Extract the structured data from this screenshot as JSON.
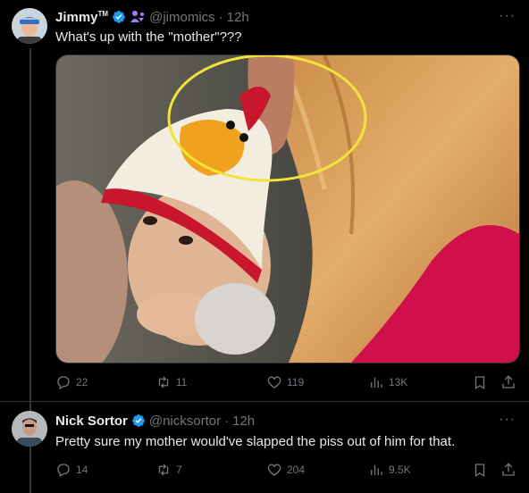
{
  "tweets": [
    {
      "author_name": "Jimmy",
      "author_suffix": "TM",
      "handle": "@jimomics",
      "time": "12h",
      "text": "What's up with the \"mother\"???",
      "stats": {
        "replies": "22",
        "reposts": "11",
        "likes": "119",
        "views": "13K"
      }
    },
    {
      "author_name": "Nick Sortor",
      "handle": "@nicksortor",
      "time": "12h",
      "text": "Pretty sure my mother would've slapped the piss out of him for that.",
      "stats": {
        "replies": "14",
        "reposts": "7",
        "likes": "204",
        "views": "9.5K"
      }
    }
  ],
  "separator": "·",
  "more_glyph": "···",
  "colors": {
    "verified": "#1d9bf0",
    "badge_purple": "#a77cf5",
    "highlight_circle": "#f2e33a",
    "sweater_pink": "#d0104a"
  },
  "icons": [
    "reply-icon",
    "repost-icon",
    "like-icon",
    "views-icon",
    "bookmark-icon",
    "share-icon"
  ]
}
